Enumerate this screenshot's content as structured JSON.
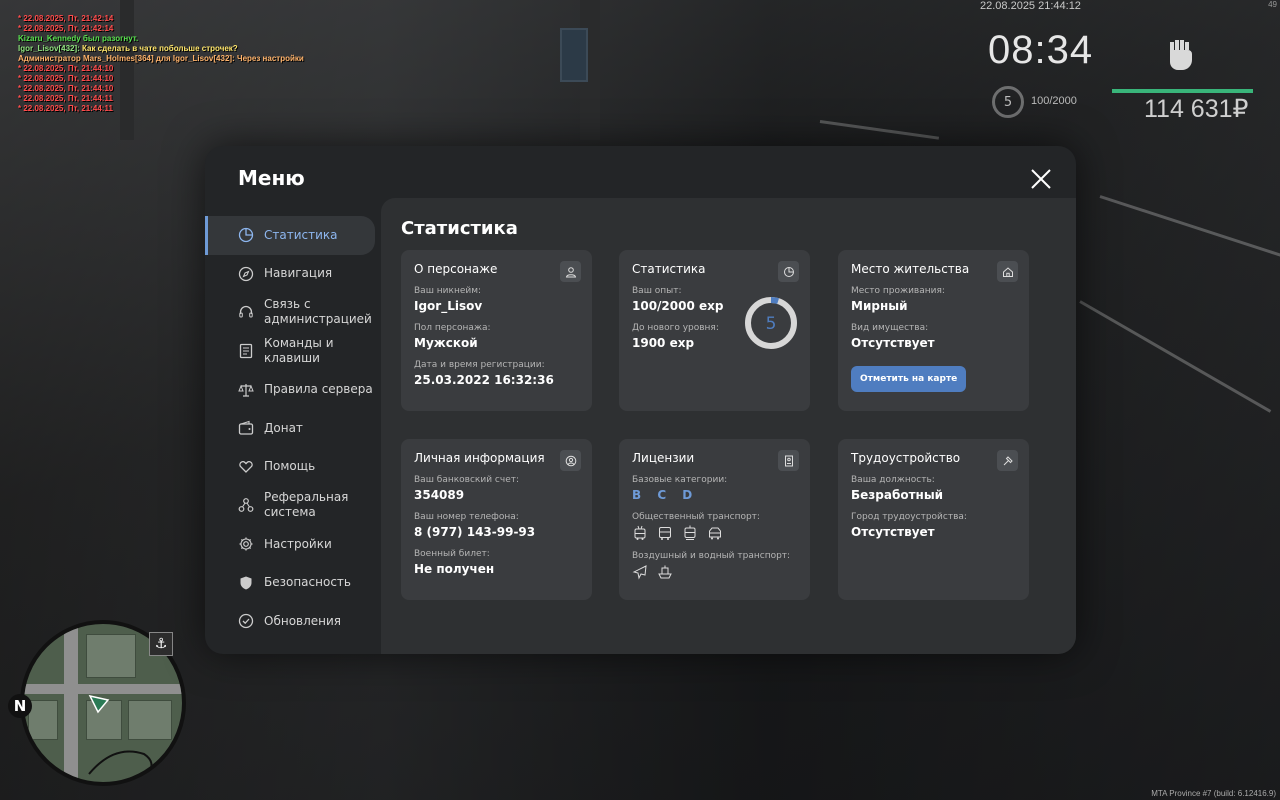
{
  "chat": [
    {
      "text": "* 22.08.2025, Пт, 21:42:14",
      "color": "red"
    },
    {
      "text": "* 22.08.2025, Пт, 21:42:14",
      "color": "red"
    },
    {
      "text": "Kizaru_Kennedy был разогнут.",
      "color": "green"
    },
    {
      "name": "Igor_Lisov[432]:",
      "text": " Как сделать в чате побольше строчек?",
      "color": "yellow"
    },
    {
      "text": "Администратор Mars_Holmes[364] для Igor_Lisov[432]: Через настройки",
      "color": "orange"
    },
    {
      "text": "* 22.08.2025, Пт, 21:44:10",
      "color": "red"
    },
    {
      "text": "* 22.08.2025, Пт, 21:44:10",
      "color": "red"
    },
    {
      "text": "* 22.08.2025, Пт, 21:44:10",
      "color": "red"
    },
    {
      "text": "* 22.08.2025, Пт, 21:44:11",
      "color": "red"
    },
    {
      "text": "* 22.08.2025, Пт, 21:44:11",
      "color": "red"
    }
  ],
  "hud": {
    "datetime": "22.08.2025 21:44:12",
    "fps": "49",
    "clock": "08:34",
    "level": "5",
    "exp": "100/2000",
    "money": "114 631₽",
    "build": "MTA Province #7 (build: 6.12416.9)",
    "accent_green": "#39b57a"
  },
  "minimap": {
    "north": "N",
    "icon": "anchor-icon"
  },
  "menu": {
    "title": "Меню",
    "accent": "#6e9ad6",
    "sidebar": [
      {
        "label": "Статистика",
        "icon": "pie-chart-icon",
        "active": true
      },
      {
        "label": "Навигация",
        "icon": "compass-icon"
      },
      {
        "label": "Связь с администрацией",
        "icon": "headset-icon"
      },
      {
        "label": "Команды и клавиши",
        "icon": "document-icon"
      },
      {
        "label": "Правила сервера",
        "icon": "scales-icon"
      },
      {
        "label": "Донат",
        "icon": "wallet-icon"
      },
      {
        "label": "Помощь",
        "icon": "heart-hand-icon"
      },
      {
        "label": "Реферальная система",
        "icon": "referral-icon"
      },
      {
        "label": "Настройки",
        "icon": "gear-icon"
      },
      {
        "label": "Безопасность",
        "icon": "shield-icon"
      },
      {
        "label": "Обновления",
        "icon": "check-circle-icon"
      }
    ],
    "page_title": "Статистика",
    "cards": {
      "character": {
        "title": "О персонаже",
        "nick_label": "Ваш никнейм:",
        "nick": "Igor_Lisov",
        "gender_label": "Пол персонажа:",
        "gender": "Мужской",
        "reg_label": "Дата и время регистрации:",
        "reg": "25.03.2022 16:32:36"
      },
      "stats": {
        "title": "Статистика",
        "exp_label": "Ваш опыт:",
        "exp": "100/2000 exp",
        "next_label": "До нового уровня:",
        "next": "1900 exp",
        "level": "5",
        "progress": 0.05
      },
      "residence": {
        "title": "Место жительства",
        "place_label": "Место проживания:",
        "place": "Мирный",
        "property_label": "Вид имущества:",
        "property": "Отсутствует",
        "button": "Отметить на карте"
      },
      "personal": {
        "title": "Личная информация",
        "bank_label": "Ваш банковский счет:",
        "bank": "354089",
        "phone_label": "Ваш номер телефона:",
        "phone": "8 (977) 143-99-93",
        "military_label": "Военный билет:",
        "military": "Не получен"
      },
      "licenses": {
        "title": "Лицензии",
        "base_label": "Базовые категории:",
        "base": "B C D",
        "public_label": "Общественный транспорт:",
        "public_icons": [
          "trolleybus-icon",
          "bus-icon",
          "tram-icon",
          "minibus-icon"
        ],
        "airwater_label": "Воздушный и водный транспорт:",
        "airwater_icons": [
          "plane-icon",
          "boat-icon"
        ]
      },
      "employment": {
        "title": "Трудоустройство",
        "position_label": "Ваша должность:",
        "position": "Безработный",
        "city_label": "Город трудоустройства:",
        "city": "Отсутствует"
      }
    }
  }
}
